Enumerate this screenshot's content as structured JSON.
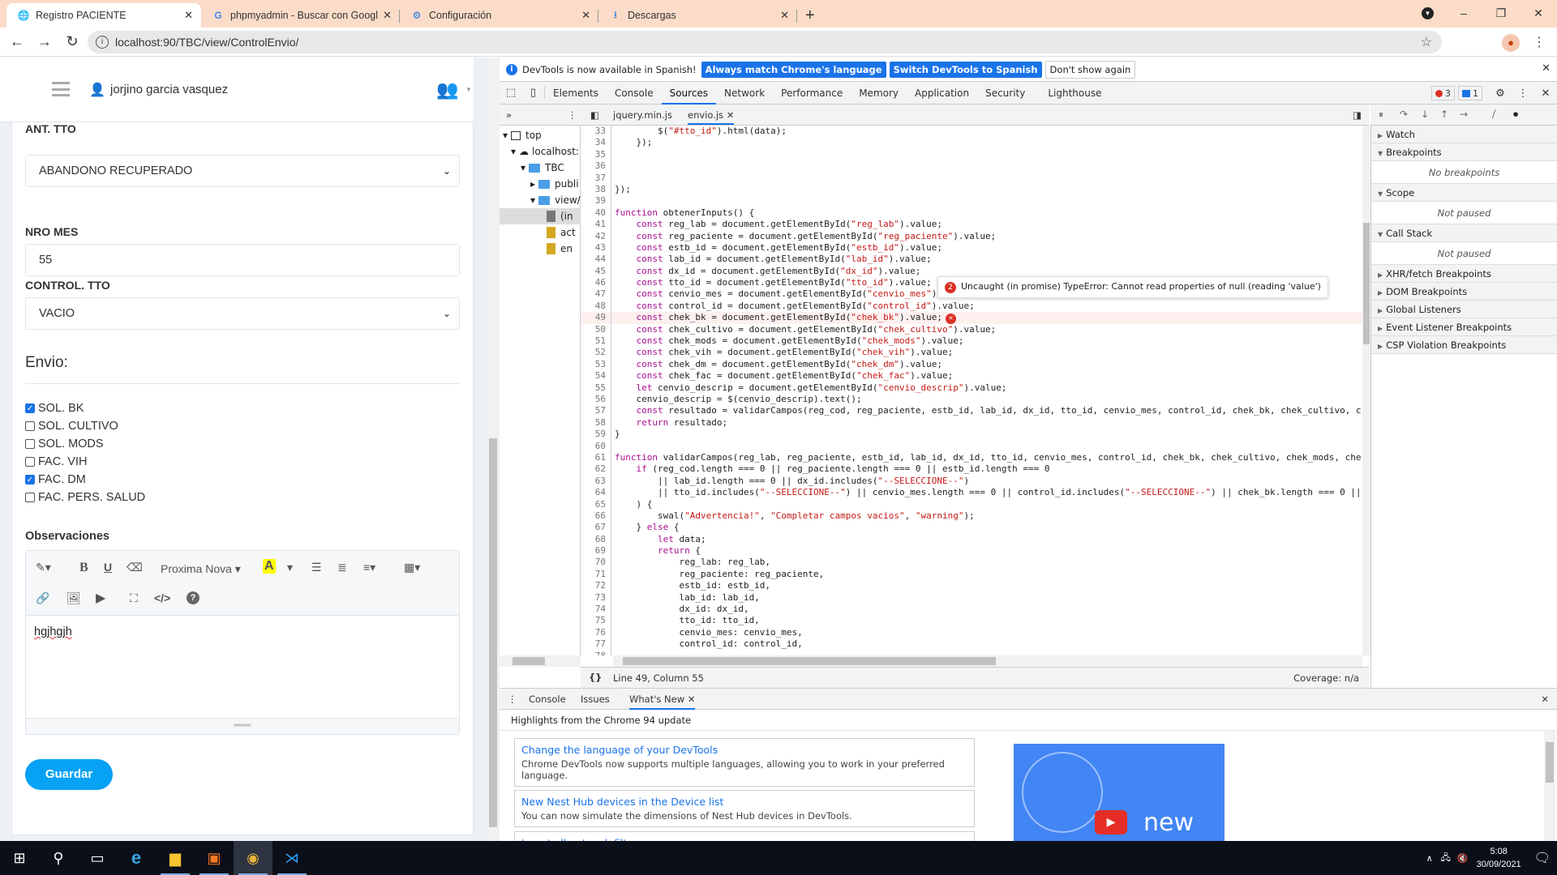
{
  "browser": {
    "tabs": [
      {
        "title": "Registro PACIENTE",
        "icon": "globe-icon",
        "active": true
      },
      {
        "title": "phpmyadmin - Buscar con Googl",
        "icon": "google-icon",
        "active": false
      },
      {
        "title": "Configuración",
        "icon": "gear-icon",
        "active": false
      },
      {
        "title": "Descargas",
        "icon": "download-icon",
        "active": false
      }
    ],
    "url": "localhost:90/TBC/view/ControlEnvio/"
  },
  "page": {
    "username": "jorjino garcia vasquez",
    "fields": {
      "ant_tto_label": "ANT. TTO",
      "ant_tto_value": "ABANDONO RECUPERADO",
      "nro_mes_label": "NRO MES",
      "nro_mes_value": "55",
      "control_tto_label": "CONTROL. TTO",
      "control_tto_value": "VACIO"
    },
    "envio_title": "Envio:",
    "checkboxes": [
      {
        "label": "SOL. BK",
        "checked": true
      },
      {
        "label": "SOL. CULTIVO",
        "checked": false
      },
      {
        "label": "SOL. MODS",
        "checked": false
      },
      {
        "label": "FAC. VIH",
        "checked": false
      },
      {
        "label": "FAC. DM",
        "checked": true
      },
      {
        "label": "FAC. PERS. SALUD",
        "checked": false
      }
    ],
    "observaciones_label": "Observaciones",
    "editor_font": "Proxima Nova",
    "editor_text": "hgjhgjh",
    "save_label": "Guardar"
  },
  "devtools": {
    "infobar": {
      "message": "DevTools is now available in Spanish!",
      "btn_match": "Always match Chrome's language",
      "btn_switch": "Switch DevTools to Spanish",
      "btn_dismiss": "Don't show again"
    },
    "main_tabs": [
      "Elements",
      "Console",
      "Sources",
      "Network",
      "Performance",
      "Memory",
      "Application",
      "Security",
      "Lighthouse"
    ],
    "active_tab": "Sources",
    "error_count": "3",
    "message_count": "1",
    "file_tabs": [
      "jquery.min.js",
      "envio.js"
    ],
    "tree": [
      {
        "label": "top"
      },
      {
        "label": "localhost:"
      },
      {
        "label": "TBC"
      },
      {
        "label": "publi"
      },
      {
        "label": "view/"
      },
      {
        "label": "(in"
      },
      {
        "label": "act"
      },
      {
        "label": "en"
      }
    ],
    "code_lines": [
      {
        "n": "33",
        "t": "        $(\"#tto_id\").html(data);"
      },
      {
        "n": "34",
        "t": "    });"
      },
      {
        "n": "35",
        "t": ""
      },
      {
        "n": "36",
        "t": ""
      },
      {
        "n": "37",
        "t": ""
      },
      {
        "n": "38",
        "t": "});"
      },
      {
        "n": "39",
        "t": ""
      },
      {
        "n": "40",
        "t": "function obtenerInputs() {"
      },
      {
        "n": "41",
        "t": "    const reg_lab = document.getElementById(\"reg_lab\").value;"
      },
      {
        "n": "42",
        "t": "    const reg_paciente = document.getElementById(\"reg_paciente\").value;"
      },
      {
        "n": "43",
        "t": "    const estb_id = document.getElementById(\"estb_id\").value;"
      },
      {
        "n": "44",
        "t": "    const lab_id = document.getElementById(\"lab_id\").value;"
      },
      {
        "n": "45",
        "t": "    const dx_id = document.getElementById(\"dx_id\").value;"
      },
      {
        "n": "46",
        "t": "    const tto_id = document.getElementById(\"tto_id\").value;"
      },
      {
        "n": "47",
        "t": "    const cenvio_mes = document.getElementById(\"cenvio_mes\").value;"
      },
      {
        "n": "48",
        "t": "    const control_id = document.getElementById(\"control_id\").value;"
      },
      {
        "n": "49",
        "t": "    const chek_bk = document.getElementById(\"chek_bk\").value;",
        "error": true
      },
      {
        "n": "50",
        "t": "    const chek_cultivo = document.getElementById(\"chek_cultivo\").value;"
      },
      {
        "n": "51",
        "t": "    const chek_mods = document.getElementById(\"chek_mods\").value;"
      },
      {
        "n": "52",
        "t": "    const chek_vih = document.getElementById(\"chek_vih\").value;"
      },
      {
        "n": "53",
        "t": "    const chek_dm = document.getElementById(\"chek_dm\").value;"
      },
      {
        "n": "54",
        "t": "    const chek_fac = document.getElementById(\"chek_fac\").value;"
      },
      {
        "n": "55",
        "t": "    let cenvio_descrip = document.getElementById(\"cenvio_descrip\").value;"
      },
      {
        "n": "56",
        "t": "    cenvio_descrip = $(cenvio_descrip).text();"
      },
      {
        "n": "57",
        "t": "    const resultado = validarCampos(reg_cod, reg_paciente, estb_id, lab_id, dx_id, tto_id, cenvio_mes, control_id, chek_bk, chek_cultivo, c"
      },
      {
        "n": "58",
        "t": "    return resultado;"
      },
      {
        "n": "59",
        "t": "}"
      },
      {
        "n": "60",
        "t": ""
      },
      {
        "n": "61",
        "t": "function validarCampos(reg_lab, reg_paciente, estb_id, lab_id, dx_id, tto_id, cenvio_mes, control_id, chek_bk, chek_cultivo, chek_mods, che"
      },
      {
        "n": "62",
        "t": "    if (reg_cod.length === 0 || reg_paciente.length === 0 || estb_id.length === 0"
      },
      {
        "n": "63",
        "t": "        || lab_id.length === 0 || dx_id.includes(\"--SELECCIONE--\")"
      },
      {
        "n": "64",
        "t": "        || tto_id.includes(\"--SELECCIONE--\") || cenvio_mes.length === 0 || control_id.includes(\"--SELECCIONE--\") || chek_bk.length === 0 ||"
      },
      {
        "n": "65",
        "t": "    ) {"
      },
      {
        "n": "66",
        "t": "        swal(\"Advertencia!\", \"Completar campos vacios\", \"warning\");"
      },
      {
        "n": "67",
        "t": "    } else {"
      },
      {
        "n": "68",
        "t": "        let data;"
      },
      {
        "n": "69",
        "t": "        return {"
      },
      {
        "n": "70",
        "t": "            reg_lab: reg_lab,"
      },
      {
        "n": "71",
        "t": "            reg_paciente: reg_paciente,"
      },
      {
        "n": "72",
        "t": "            estb_id: estb_id,"
      },
      {
        "n": "73",
        "t": "            lab_id: lab_id,"
      },
      {
        "n": "74",
        "t": "            dx_id: dx_id,"
      },
      {
        "n": "75",
        "t": "            tto_id: tto_id,"
      },
      {
        "n": "76",
        "t": "            cenvio_mes: cenvio_mes,"
      },
      {
        "n": "77",
        "t": "            control_id: control_id,"
      },
      {
        "n": "78",
        "t": ""
      }
    ],
    "error_tooltip": {
      "count": "2",
      "message": "Uncaught (in promise) TypeError: Cannot read properties of null (reading 'value')"
    },
    "status": {
      "position": "Line 49, Column 55",
      "coverage": "Coverage: n/a"
    },
    "debugger": {
      "sections": [
        {
          "label": "Watch",
          "expanded": false
        },
        {
          "label": "Breakpoints",
          "expanded": true,
          "body": "No breakpoints"
        },
        {
          "label": "Scope",
          "expanded": true,
          "body": "Not paused"
        },
        {
          "label": "Call Stack",
          "expanded": true,
          "body": "Not paused"
        },
        {
          "label": "XHR/fetch Breakpoints",
          "expanded": false
        },
        {
          "label": "DOM Breakpoints",
          "expanded": false
        },
        {
          "label": "Global Listeners",
          "expanded": false
        },
        {
          "label": "Event Listener Breakpoints",
          "expanded": false
        },
        {
          "label": "CSP Violation Breakpoints",
          "expanded": false
        }
      ]
    },
    "drawer": {
      "tabs": [
        "Console",
        "Issues",
        "What's New"
      ],
      "active_tab": "What's New",
      "headline": "Highlights from the Chrome 94 update",
      "cards": [
        {
          "title": "Change the language of your DevTools",
          "desc": "Chrome DevTools now supports multiple languages, allowing you to work in your preferred language."
        },
        {
          "title": "New Nest Hub devices in the Device list",
          "desc": "You can now simulate the dimensions of Nest Hub devices in DevTools."
        },
        {
          "title": "Invert all network filters",
          "desc": ""
        }
      ],
      "video_text": "new"
    }
  },
  "taskbar": {
    "time": "5:08",
    "date": "30/09/2021"
  }
}
